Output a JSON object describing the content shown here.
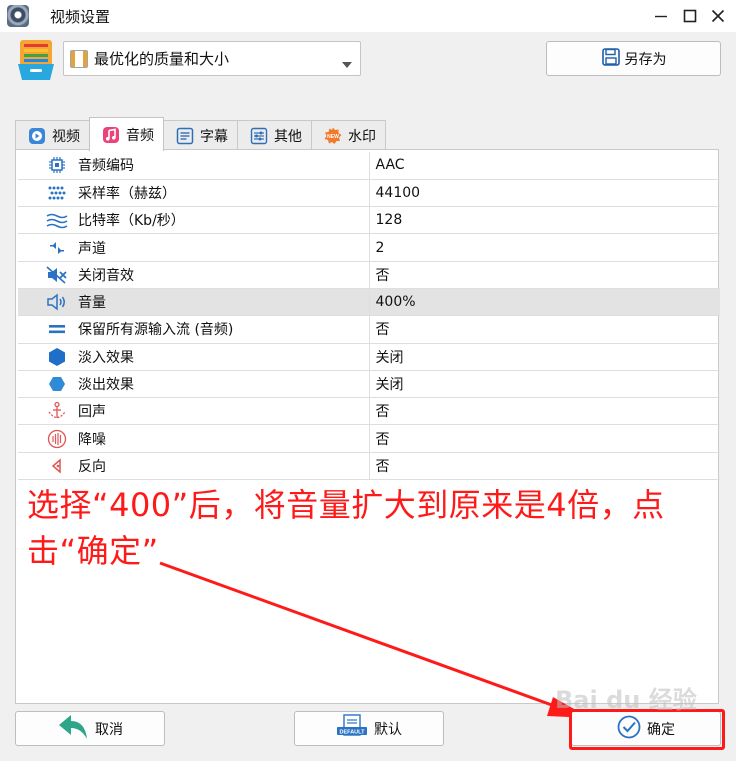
{
  "window": {
    "title": "视频设置"
  },
  "preset": {
    "value": "最优化的质量和大小"
  },
  "toolbar": {
    "save_as_label": "另存为"
  },
  "tabs": [
    {
      "label": "视频",
      "icon": "video-play-icon",
      "active": false
    },
    {
      "label": "音频",
      "icon": "music-note-icon",
      "active": true
    },
    {
      "label": "字幕",
      "icon": "subtitle-icon",
      "active": false
    },
    {
      "label": "其他",
      "icon": "sliders-icon",
      "active": false
    },
    {
      "label": "水印",
      "icon": "new-badge-icon",
      "active": false
    }
  ],
  "audio_settings": [
    {
      "label": "音频编码",
      "value": "AAC",
      "icon": "chip-icon"
    },
    {
      "label": "采样率（赫兹）",
      "value": "44100",
      "icon": "sample-rate-icon"
    },
    {
      "label": "比特率（Kb/秒）",
      "value": "128",
      "icon": "bitrate-wave-icon"
    },
    {
      "label": "声道",
      "value": "2",
      "icon": "channels-icon"
    },
    {
      "label": "关闭音效",
      "value": "否",
      "icon": "mute-speaker-icon"
    },
    {
      "label": "音量",
      "value": "400%",
      "icon": "volume-speaker-icon",
      "highlighted": true
    },
    {
      "label": "保留所有源输入流 (音频)",
      "value": "否",
      "icon": "equals-icon"
    },
    {
      "label": "淡入效果",
      "value": "关闭",
      "icon": "fade-in-hexagon-icon"
    },
    {
      "label": "淡出效果",
      "value": "关闭",
      "icon": "fade-out-hexagon-icon"
    },
    {
      "label": "回声",
      "value": "否",
      "icon": "echo-icon"
    },
    {
      "label": "降噪",
      "value": "否",
      "icon": "noise-reduction-icon"
    },
    {
      "label": "反向",
      "value": "否",
      "icon": "reverse-icon"
    }
  ],
  "annotation": {
    "text": "选择“400”后，将音量扩大到原来是4倍，点击“确定”",
    "color": "#ff1a1a"
  },
  "footer": {
    "cancel_label": "取消",
    "default_label": "默认",
    "ok_label": "确定"
  },
  "watermark": {
    "text": "Bai du 经验"
  }
}
